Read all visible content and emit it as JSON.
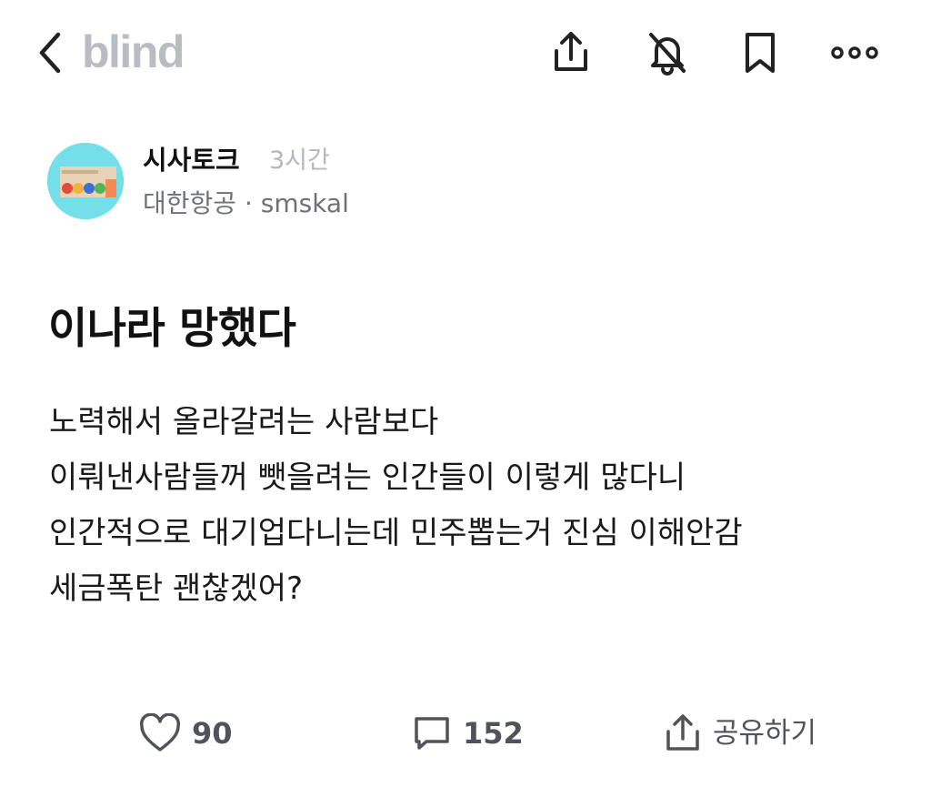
{
  "header": {
    "logo": "blind",
    "icons": [
      "chevron-left-icon",
      "share-icon",
      "bell-off-icon",
      "bookmark-icon",
      "more-icon"
    ]
  },
  "author": {
    "channel": "시사토크",
    "time": "3시간",
    "company_line": "대한항공 · smskal"
  },
  "post": {
    "title": "이나라 망했다",
    "body": [
      "노력해서 올라갈려는 사람보다",
      "이뤄낸사람들꺼 뺏을려는 인간들이 이렇게 많다니",
      "인간적으로 대기업다니는데 민주뽑는거 진심 이해안감",
      "세금폭탄 괜찮겠어?"
    ]
  },
  "actions": {
    "likes": "90",
    "comments": "152",
    "share_label": "공유하기"
  },
  "colors": {
    "logo": "#b9bcc2",
    "avatar_bg": "#74dfe9",
    "muted_text": "#6e7178",
    "time_text": "#b4b7bd"
  }
}
